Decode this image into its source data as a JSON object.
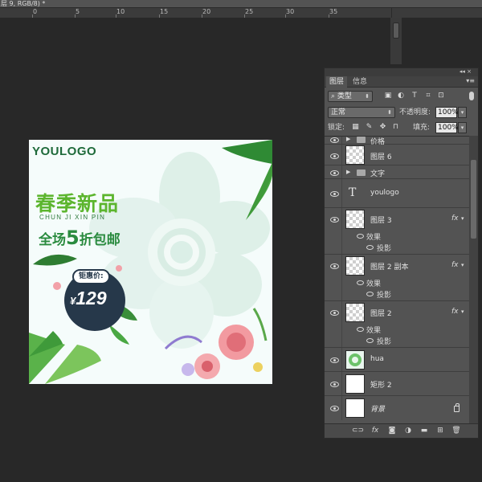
{
  "document": {
    "tab_title": "层 9, RGB/8) *",
    "ruler_marks": [
      "0",
      "5",
      "10",
      "15",
      "20",
      "25",
      "30",
      "35"
    ]
  },
  "poster": {
    "logo": "YOULOGO",
    "title": "春季新品",
    "pinyin": "CHUN JI XIN PIN",
    "sale_prefix": "全场",
    "sale_number": "5",
    "sale_suffix": "折包邮",
    "price_label": "钜惠价:",
    "price_currency": "¥",
    "price_value": "129",
    "colors": {
      "title_green": "#5cb52e",
      "logo_green": "#1e6a3a",
      "price_bg": "#26384a"
    }
  },
  "layers_panel": {
    "tabs": [
      "图层",
      "信息"
    ],
    "active_tab": "图层",
    "filter_kind": "类型",
    "blend_mode": "正常",
    "opacity_label": "不透明度:",
    "opacity_value": "100%",
    "lock_label": "锁定:",
    "fill_label": "填充:",
    "fill_value": "100%",
    "layers": [
      {
        "name": "价格",
        "kind": "group"
      },
      {
        "name": "图层 6",
        "kind": "smart"
      },
      {
        "name": "文字",
        "kind": "group"
      },
      {
        "name": "youlogo",
        "kind": "text"
      },
      {
        "name": "图层 3",
        "kind": "pixel",
        "fx": "fx",
        "effects_label": "效果",
        "effect": "投影"
      },
      {
        "name": "图层 2 副本",
        "kind": "pixel",
        "fx": "fx",
        "effects_label": "效果",
        "effect": "投影"
      },
      {
        "name": "图层 2",
        "kind": "pixel",
        "fx": "fx",
        "effects_label": "效果",
        "effect": "投影"
      },
      {
        "name": "hua",
        "kind": "image"
      },
      {
        "name": "矩形 2",
        "kind": "shape"
      },
      {
        "name": "背景",
        "kind": "background",
        "locked": true
      }
    ]
  }
}
